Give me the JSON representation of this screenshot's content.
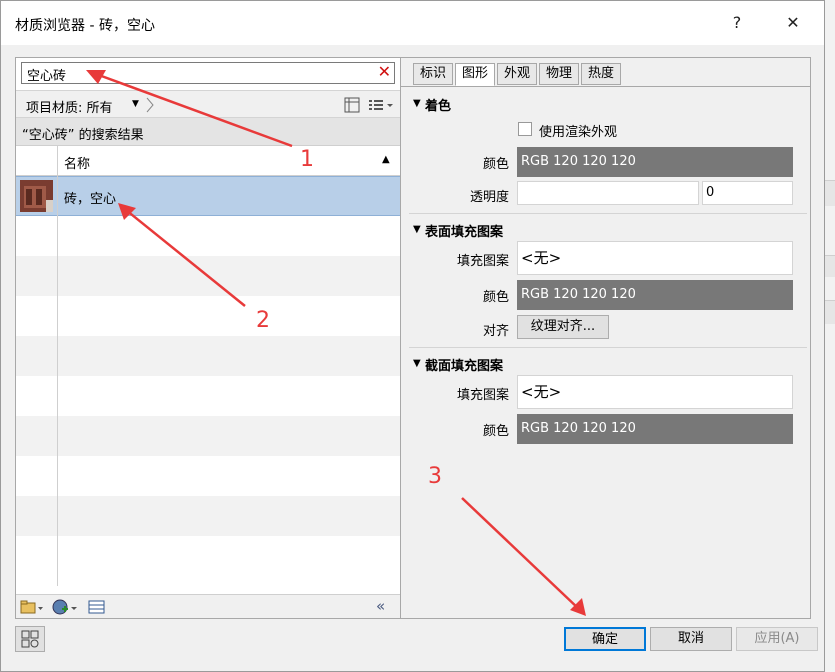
{
  "window": {
    "title": "材质浏览器 - 砖，空心",
    "help_glyph": "?",
    "close_glyph": "✕"
  },
  "search": {
    "value": "空心砖",
    "clear_glyph": "✕"
  },
  "toolbar": {
    "filter_label": "项目材质: 所有",
    "dropdown_glyph": "▼"
  },
  "results": {
    "header": "“空心砖” 的搜索结果",
    "column_name": "名称",
    "sort_glyph": "▲",
    "items": [
      {
        "name": "砖，空心"
      }
    ]
  },
  "tabs": [
    {
      "label": "标识",
      "active": false
    },
    {
      "label": "图形",
      "active": true
    },
    {
      "label": "外观",
      "active": false
    },
    {
      "label": "物理",
      "active": false
    },
    {
      "label": "热度",
      "active": false
    }
  ],
  "shading": {
    "title": "着色",
    "use_render_label": "使用渲染外观",
    "color_label": "颜色",
    "color_value": "RGB 120 120 120",
    "transparency_label": "透明度",
    "transparency_value": "0"
  },
  "surface": {
    "title": "表面填充图案",
    "pattern_label": "填充图案",
    "pattern_value": "<无>",
    "color_label": "颜色",
    "color_value": "RGB 120 120 120",
    "align_label": "对齐",
    "align_button": "纹理对齐..."
  },
  "cut": {
    "title": "截面填充图案",
    "pattern_label": "填充图案",
    "pattern_value": "<无>",
    "color_label": "颜色",
    "color_value": "RGB 120 120 120"
  },
  "footer": {
    "ok": "确定",
    "cancel": "取消",
    "apply": "应用(A)"
  },
  "annotations": {
    "a1": "1",
    "a2": "2",
    "a3": "3"
  },
  "colors": {
    "accent": "#0078d7",
    "selection": "#b8cfe8",
    "swatch": "#787878",
    "annotation": "#e83a3a"
  }
}
